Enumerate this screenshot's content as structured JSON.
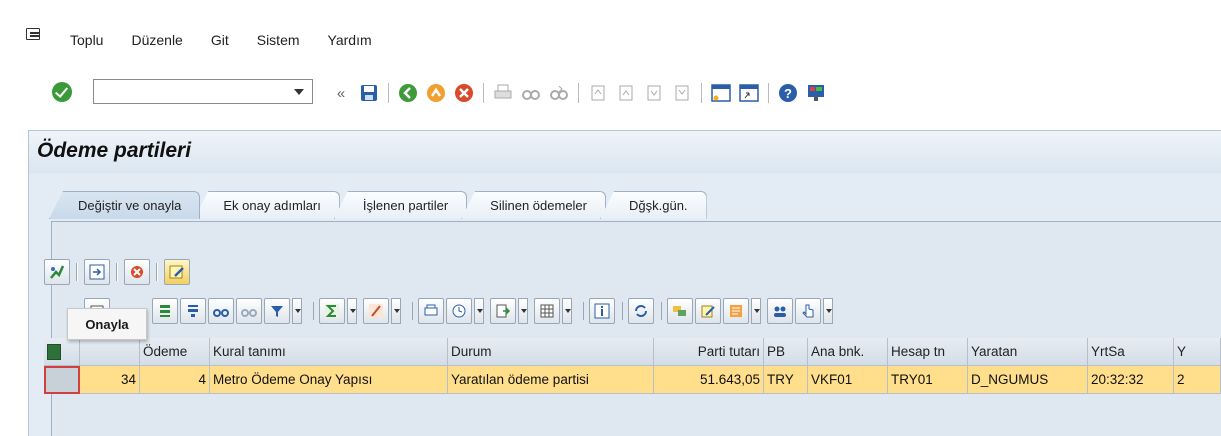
{
  "menu": {
    "items": [
      {
        "label": "Toplu"
      },
      {
        "label": "Düzenle"
      },
      {
        "label": "Git"
      },
      {
        "label": "Sistem"
      },
      {
        "label": "Yardım"
      }
    ]
  },
  "toolbar": {
    "command_value": "",
    "back_glyph": "«"
  },
  "page": {
    "title": "Ödeme partileri"
  },
  "tabs": [
    {
      "label": "Değiştir ve onayla",
      "active": true
    },
    {
      "label": "Ek onay adımları",
      "active": false
    },
    {
      "label": "İşlenen partiler",
      "active": false
    },
    {
      "label": "Silinen ödemeler",
      "active": false
    },
    {
      "label": "Dğşk.gün.",
      "active": false
    }
  ],
  "tooltip": {
    "text": "Onayla"
  },
  "grid": {
    "columns": [
      "",
      "",
      "Ödeme",
      "Kural tanımı",
      "Durum",
      "Parti tutarı",
      "PB",
      "Ana bnk.",
      "Hesap tn",
      "Yaratan",
      "YrtSa",
      "Y"
    ],
    "rows": [
      [
        "",
        "34",
        "4",
        "Metro Ödeme Onay Yapısı",
        "Yaratılan ödeme partisi",
        "51.643,05",
        "TRY",
        "VKF01",
        "TRY01",
        "D_NGUMUS",
        "20:32:32",
        "2"
      ]
    ]
  },
  "colors": {
    "row_highlight": "#ffdf8c",
    "panel_bg": "#e3ecf5",
    "ok_green": "#3a9a3a"
  }
}
